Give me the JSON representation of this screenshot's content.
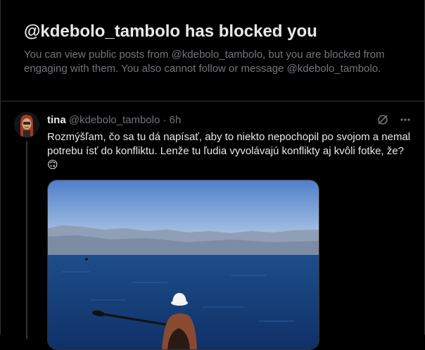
{
  "blocked_notice": {
    "title": "@kdebolo_tambolo has blocked you",
    "description": "You can view public posts from @kdebolo_tambolo, but you are blocked from engaging with them. You also cannot follow or message @kdebolo_tambolo."
  },
  "post": {
    "display_name": "tina",
    "handle": "@kdebolo_tambolo",
    "separator": "·",
    "timestamp": "6h",
    "text": "Rozmýšľam, čo sa tu dá napísať, aby to niekto nepochopil po svojom a nemal potrebu ísť do konfliktu. Lenže tu ľudia vyvolávajú konflikty aj kvôli fotke, že? 🙃",
    "icons": [
      "grok-icon",
      "more-icon"
    ]
  },
  "colors": {
    "background": "#000000",
    "text_primary": "#e7e9ea",
    "text_secondary": "#71767b",
    "border": "#2f3336"
  }
}
